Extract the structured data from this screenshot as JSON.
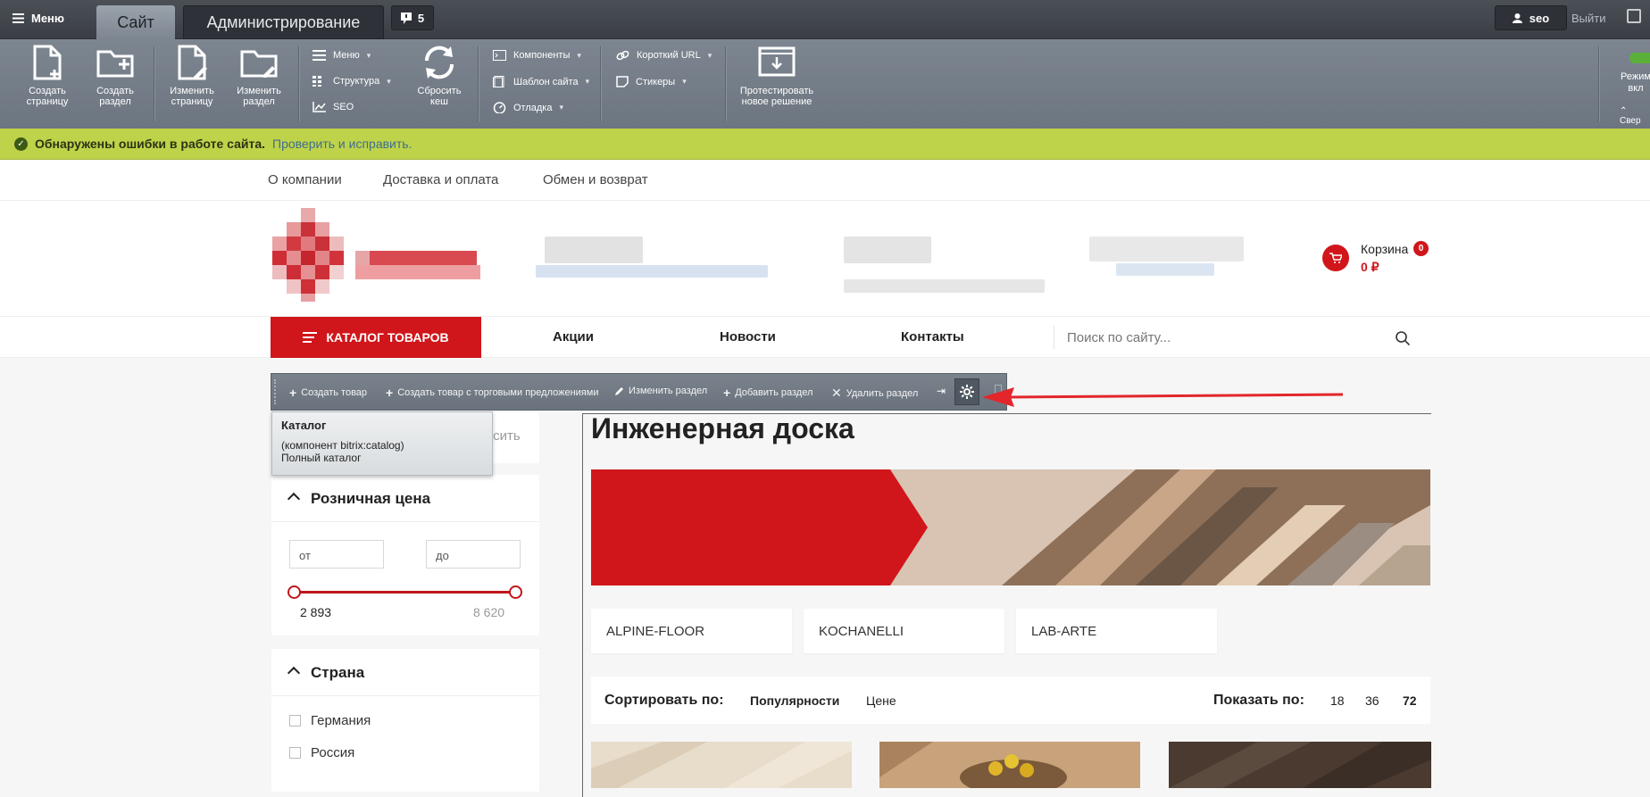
{
  "admin": {
    "menu_label": "Меню",
    "tab_site": "Сайт",
    "tab_admin": "Администрирование",
    "notifications_count": "5",
    "user_label": "seo",
    "logout_label": "Выйти"
  },
  "toolbar": {
    "create_page": "Создать\nстраницу",
    "create_section": "Создать\nраздел",
    "edit_page": "Изменить\nстраницу",
    "edit_section": "Изменить\nраздел",
    "menu": "Меню",
    "structure": "Структура",
    "seo": "SEO",
    "reset_cache": "Сбросить\nкеш",
    "components": "Компоненты",
    "site_template": "Шаблон сайта",
    "debug": "Отладка",
    "short_url": "Короткий URL",
    "stickers": "Стикеры",
    "test_solution": "Протестировать\nновое решение",
    "mode_partial": "Режим",
    "mode_partial2": "вкл",
    "collapse_partial": "Свер"
  },
  "errbar": {
    "text": "Обнаружены ошибки в работе сайта.",
    "link": "Проверить и исправить."
  },
  "topnav": [
    "О компании",
    "Доставка и оплата",
    "Обмен и возврат"
  ],
  "cart": {
    "label": "Корзина",
    "count": "0",
    "price": "0 ₽"
  },
  "mainnav": {
    "catalog": "КАТАЛОГ ТОВАРОВ",
    "links": [
      "Акции",
      "Новости",
      "Контакты"
    ],
    "search_placeholder": "Поиск по сайту..."
  },
  "component_toolbar": {
    "create_product": "Создать товар",
    "create_product_offers": "Создать товар с торговыми предложениями",
    "edit_section": "Изменить раздел",
    "add_section": "Добавить раздел",
    "delete_section": "Удалить раздел"
  },
  "tooltip": {
    "title": "Каталог",
    "line1": "(компонент bitrix:catalog)",
    "line2": "Полный каталог"
  },
  "filter": {
    "reset_partial": "Сбросить",
    "price_title": "Розничная цена",
    "from_placeholder": "от",
    "to_placeholder": "до",
    "min_value": "2 893",
    "max_value": "8 620",
    "country_title": "Страна",
    "countries": [
      "Германия",
      "Россия"
    ]
  },
  "main": {
    "title": "Инженерная доска",
    "brands": [
      "ALPINE-FLOOR",
      "KOCHANELLI",
      "LAB-ARTE"
    ],
    "sort_label": "Сортировать по:",
    "sort_options": [
      "Популярности",
      "Цене"
    ],
    "show_label": "Показать по:",
    "show_options": [
      "18",
      "36",
      "72"
    ]
  },
  "colors": {
    "brand_red": "#d0161b",
    "admin_bar": "#3f444a",
    "error_bar": "#bfd34a"
  }
}
